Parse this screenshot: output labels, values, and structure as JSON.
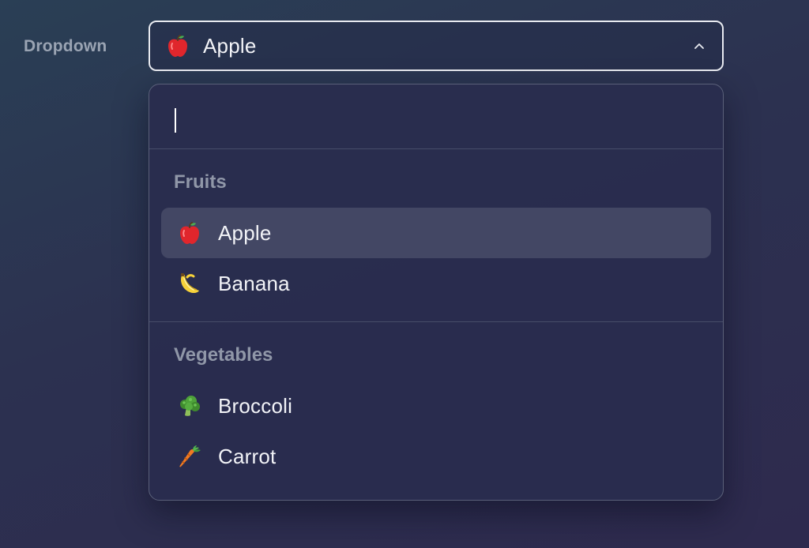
{
  "field": {
    "label": "Dropdown"
  },
  "select": {
    "value": "Apple",
    "value_icon": "apple-icon",
    "expanded": true,
    "chevron_icon": "chevron-up-icon"
  },
  "search": {
    "value": "",
    "placeholder": ""
  },
  "groups": [
    {
      "label": "Fruits",
      "options": [
        {
          "label": "Apple",
          "icon": "apple-icon",
          "selected": true
        },
        {
          "label": "Banana",
          "icon": "banana-icon",
          "selected": false
        }
      ]
    },
    {
      "label": "Vegetables",
      "options": [
        {
          "label": "Broccoli",
          "icon": "broccoli-icon",
          "selected": false
        },
        {
          "label": "Carrot",
          "icon": "carrot-icon",
          "selected": false
        }
      ]
    }
  ],
  "colors": {
    "selected_row": "#434764",
    "border_focus": "#e8eaf0",
    "group_label": "#9097a8"
  }
}
